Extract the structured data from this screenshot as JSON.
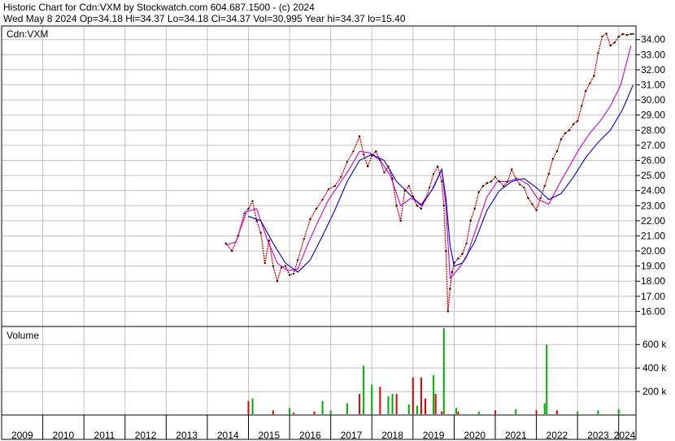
{
  "header": {
    "line1": "Historic Chart for Cdn:VXM by Stockwatch.com 604.687.1500 - (c) 2024",
    "line2": "Wed May  8 2024   Op=34.18   Hi=34.37   Lo=34.18   Cl=34.37   Vol=30,995   Year hi=34.37   lo=15.40"
  },
  "colors": {
    "price": "#cc0000",
    "ma_short": "#cc00cc",
    "ma_long": "#0000cc",
    "vol_up": "#00aa00",
    "vol_down": "#dd0000",
    "grid": "#c0c0c0"
  },
  "chart_data": [
    {
      "type": "line",
      "title": "Cdn:VXM",
      "ylim": [
        15,
        34.9
      ],
      "y_ticks": [
        "16.00",
        "17.00",
        "18.00",
        "19.00",
        "20.00",
        "21.00",
        "22.00",
        "23.00",
        "24.00",
        "25.00",
        "26.00",
        "27.00",
        "28.00",
        "29.00",
        "30.00",
        "31.00",
        "32.00",
        "33.00",
        "34.00"
      ],
      "x_ticks": [
        "2009",
        "2010",
        "2011",
        "2012",
        "2013",
        "2014",
        "2015",
        "2016",
        "2017",
        "2018",
        "2019",
        "2020",
        "2021",
        "2022",
        "2023",
        "2024"
      ],
      "xlim": [
        2009.0,
        2024.42
      ],
      "series": [
        {
          "role": "price",
          "x": [
            2014.45,
            2014.6,
            2014.75,
            2014.9,
            2015.0,
            2015.1,
            2015.2,
            2015.3,
            2015.4,
            2015.5,
            2015.6,
            2015.7,
            2015.8,
            2015.9,
            2016.0,
            2016.1,
            2016.2,
            2016.35,
            2016.5,
            2016.65,
            2016.8,
            2016.95,
            2017.1,
            2017.25,
            2017.4,
            2017.55,
            2017.7,
            2017.8,
            2017.9,
            2018.0,
            2018.1,
            2018.2,
            2018.3,
            2018.4,
            2018.5,
            2018.6,
            2018.7,
            2018.8,
            2018.9,
            2019.0,
            2019.1,
            2019.2,
            2019.3,
            2019.4,
            2019.5,
            2019.6,
            2019.7,
            2019.75,
            2019.8,
            2019.85,
            2019.9,
            2019.95,
            2020.0,
            2020.1,
            2020.2,
            2020.3,
            2020.4,
            2020.5,
            2020.6,
            2020.7,
            2020.8,
            2020.9,
            2021.0,
            2021.1,
            2021.2,
            2021.3,
            2021.4,
            2021.5,
            2021.6,
            2021.7,
            2021.8,
            2021.9,
            2022.0,
            2022.1,
            2022.2,
            2022.3,
            2022.4,
            2022.5,
            2022.6,
            2022.7,
            2022.8,
            2022.9,
            2023.0,
            2023.1,
            2023.2,
            2023.3,
            2023.4,
            2023.5,
            2023.6,
            2023.7,
            2023.8,
            2023.9,
            2024.0,
            2024.1,
            2024.2,
            2024.3,
            2024.35
          ],
          "values": [
            20.5,
            20.0,
            21.0,
            22.5,
            22.8,
            23.3,
            22.0,
            21.2,
            19.2,
            20.7,
            19.0,
            18.0,
            18.9,
            19.0,
            18.4,
            18.5,
            19.4,
            20.8,
            22.1,
            22.8,
            23.4,
            24.1,
            24.3,
            24.9,
            25.9,
            26.6,
            27.6,
            26.4,
            25.6,
            26.3,
            26.6,
            26.0,
            25.2,
            25.6,
            24.8,
            23.0,
            22.0,
            24.0,
            24.3,
            23.6,
            23.0,
            22.8,
            23.4,
            24.2,
            25.1,
            25.6,
            24.6,
            23.0,
            20.0,
            16.0,
            17.5,
            18.6,
            19.2,
            19.5,
            19.8,
            20.5,
            22.0,
            22.8,
            23.9,
            24.3,
            24.5,
            24.6,
            24.9,
            24.6,
            24.3,
            24.6,
            25.4,
            24.8,
            24.4,
            24.2,
            23.5,
            23.1,
            22.7,
            23.5,
            24.3,
            25.1,
            26.1,
            26.6,
            27.4,
            27.8,
            28.0,
            28.4,
            28.6,
            29.6,
            30.6,
            31.1,
            31.6,
            33.1,
            34.2,
            34.4,
            33.6,
            33.8,
            34.2,
            34.37,
            34.3,
            34.37,
            34.37
          ]
        },
        {
          "role": "ma_short",
          "x": [
            2014.45,
            2014.7,
            2014.95,
            2015.2,
            2015.45,
            2015.7,
            2015.95,
            2016.2,
            2016.45,
            2016.7,
            2016.95,
            2017.2,
            2017.45,
            2017.7,
            2017.95,
            2018.2,
            2018.45,
            2018.7,
            2018.95,
            2019.2,
            2019.45,
            2019.7,
            2019.8,
            2019.9,
            2020.1,
            2020.3,
            2020.55,
            2020.8,
            2021.05,
            2021.3,
            2021.55,
            2021.8,
            2022.05,
            2022.3,
            2022.55,
            2022.8,
            2023.05,
            2023.3,
            2023.55,
            2023.8,
            2024.05,
            2024.3
          ],
          "values": [
            20.4,
            20.6,
            22.6,
            22.8,
            20.8,
            19.2,
            18.7,
            18.8,
            20.5,
            22.0,
            23.4,
            24.4,
            25.4,
            26.6,
            26.5,
            26.0,
            25.0,
            23.0,
            23.5,
            23.1,
            24.0,
            25.4,
            23.0,
            18.2,
            18.8,
            19.6,
            21.6,
            23.6,
            24.6,
            24.6,
            24.8,
            24.4,
            23.4,
            23.1,
            24.4,
            25.6,
            26.8,
            27.8,
            28.6,
            29.6,
            31.0,
            33.6
          ]
        },
        {
          "role": "ma_long",
          "x": [
            2015.0,
            2015.3,
            2015.6,
            2015.9,
            2016.2,
            2016.5,
            2016.8,
            2017.1,
            2017.4,
            2017.7,
            2018.0,
            2018.3,
            2018.6,
            2018.9,
            2019.2,
            2019.5,
            2019.7,
            2019.8,
            2019.9,
            2020.0,
            2020.2,
            2020.5,
            2020.8,
            2021.1,
            2021.4,
            2021.7,
            2022.0,
            2022.3,
            2022.6,
            2022.9,
            2023.2,
            2023.5,
            2023.8,
            2024.1,
            2024.35
          ],
          "values": [
            22.3,
            22.0,
            20.5,
            19.2,
            18.6,
            19.4,
            21.0,
            22.7,
            24.6,
            26.0,
            26.4,
            26.0,
            24.6,
            23.8,
            23.0,
            24.2,
            25.4,
            23.5,
            20.4,
            19.0,
            19.2,
            20.6,
            22.7,
            24.0,
            24.6,
            24.8,
            24.2,
            23.4,
            23.8,
            24.9,
            26.2,
            27.2,
            28.0,
            29.4,
            31.0
          ]
        }
      ]
    },
    {
      "type": "bar",
      "title": "Volume",
      "ylim": [
        0,
        740
      ],
      "y_ticks": [
        "200 k",
        "400 k",
        "600 k"
      ],
      "x": [
        2015.0,
        2015.1,
        2015.6,
        2016.0,
        2016.1,
        2016.6,
        2016.8,
        2017.0,
        2017.4,
        2017.7,
        2017.8,
        2018.0,
        2018.2,
        2018.4,
        2018.5,
        2018.6,
        2018.9,
        2019.0,
        2019.1,
        2019.2,
        2019.3,
        2019.5,
        2019.55,
        2019.7,
        2019.75,
        2020.05,
        2020.1,
        2020.6,
        2021.0,
        2021.5,
        2022.0,
        2022.2,
        2022.25,
        2022.5,
        2023.0,
        2023.5,
        2024.0
      ],
      "values": [
        120,
        140,
        40,
        60,
        20,
        30,
        120,
        40,
        100,
        180,
        420,
        260,
        240,
        160,
        180,
        180,
        90,
        320,
        80,
        320,
        140,
        340,
        180,
        30,
        740,
        60,
        30,
        30,
        40,
        50,
        40,
        100,
        600,
        40,
        30,
        40,
        50
      ],
      "up": [
        false,
        true,
        false,
        true,
        false,
        false,
        true,
        true,
        true,
        false,
        true,
        true,
        false,
        true,
        true,
        false,
        true,
        false,
        true,
        false,
        false,
        true,
        false,
        false,
        true,
        true,
        false,
        true,
        false,
        true,
        false,
        true,
        true,
        false,
        true,
        true,
        true
      ]
    }
  ],
  "price_panel": {
    "label": "Cdn:VXM"
  },
  "volume_panel": {
    "label": "Volume"
  }
}
